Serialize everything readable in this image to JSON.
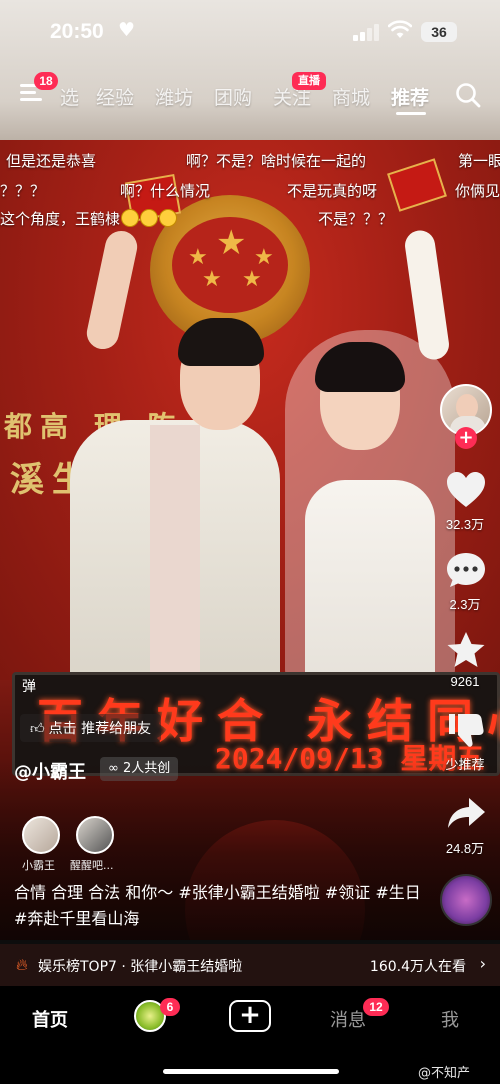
{
  "status_bar": {
    "time": "20:50",
    "battery": "36"
  },
  "top_nav": {
    "menu_badge": "18",
    "tabs": [
      {
        "label": "选"
      },
      {
        "label": "经验"
      },
      {
        "label": "潍坊"
      },
      {
        "label": "团购"
      },
      {
        "label": "关注",
        "badge": "直播"
      },
      {
        "label": "商城"
      },
      {
        "label": "推荐",
        "active": true
      }
    ],
    "search_icon": "search-icon"
  },
  "danmaku": [
    "但是还是恭喜",
    "啊？不是？啥时候在一起的",
    "第一眼",
    "？？？",
    "啊？什么情况",
    "不是玩真的呀",
    "你俩见",
    "这个角度，王鹤棣",
    "不是？？？"
  ],
  "video": {
    "sign_line1": "都高  理  陈",
    "sign_line2": "溪生  处",
    "led_line1": "百年好合 永结同心",
    "led_line2": "2024/09/13 星期五 14:29:41"
  },
  "right_rail": {
    "likes": "32.3万",
    "comments": "2.3万",
    "favorites": "9261",
    "not_interested": "少推荐",
    "shares": "24.8万"
  },
  "info": {
    "danmu_toggle": "弹",
    "recommend": "点击 推荐给朋友",
    "author": "@小霸王",
    "cocreate": "2人共创",
    "co_creators": [
      "小霸王",
      "醒醒吧..."
    ],
    "caption": "合情 合理 合法 和你～ #张律小霸王结婚啦 #领证 #生日 #奔赴千里看山海"
  },
  "hot_bar": {
    "topic": "娱乐榜TOP7 · 张律小霸王结婚啦",
    "watching": "160.4万人在看"
  },
  "bottom_nav": {
    "home": "首页",
    "friends_badge": "6",
    "messages": "消息",
    "messages_badge": "12",
    "me": "我"
  },
  "watermark": "@不知产"
}
